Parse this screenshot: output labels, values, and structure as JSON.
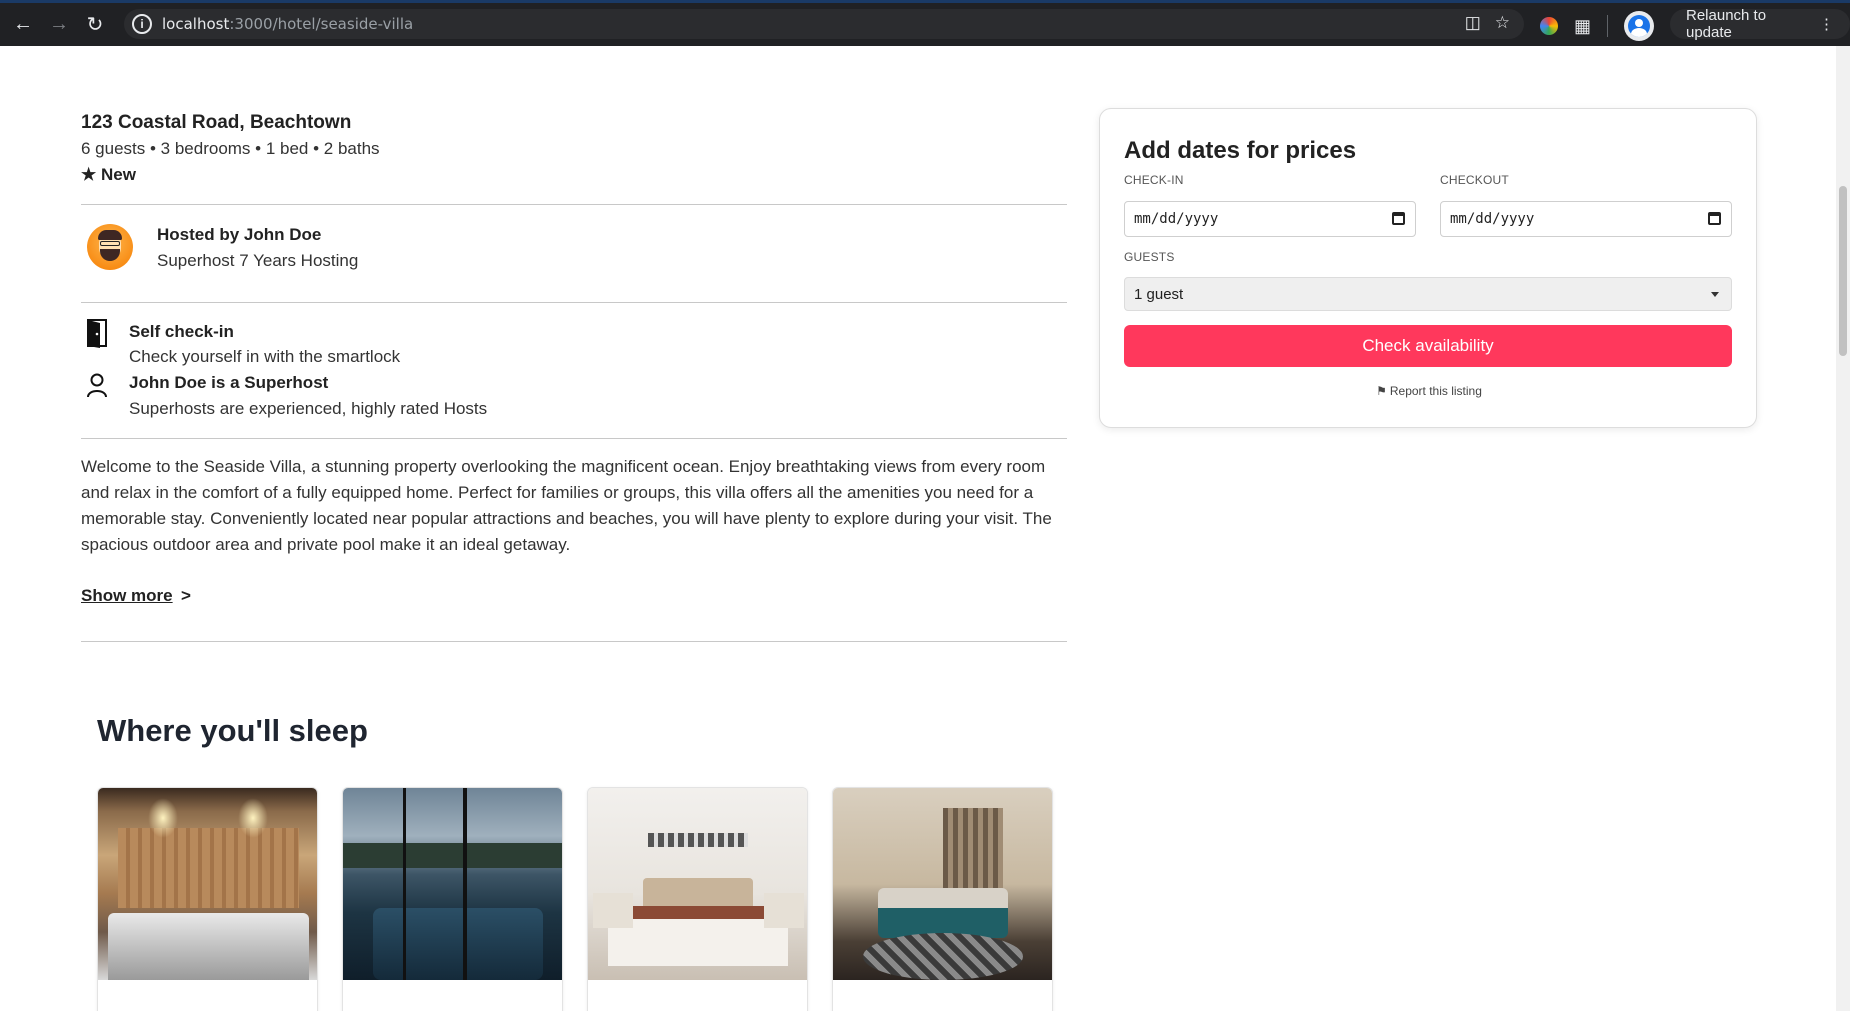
{
  "browser": {
    "url_host": "localhost",
    "url_path": ":3000/hotel/seaside-villa",
    "relaunch_label": "Relaunch to update"
  },
  "listing": {
    "address": "123 Coastal Road, Beachtown",
    "specs": "6 guests • 3 bedrooms • 1 bed • 2 baths",
    "badge": "★ New"
  },
  "host": {
    "name": "Hosted by John Doe",
    "subtitle": "Superhost 7 Years Hosting"
  },
  "features": [
    {
      "icon": "door-icon",
      "title": "Self check-in",
      "text": "Check yourself in with the smartlock"
    },
    {
      "icon": "user-icon",
      "title": "John Doe is a Superhost",
      "text": "Superhosts are experienced, highly rated Hosts"
    }
  ],
  "description": "Welcome to the Seaside Villa, a stunning property overlooking the magnificent ocean. Enjoy breathtaking views from every room and relax in the comfort of a fully equipped home. Perfect for families or groups, this villa offers all the amenities you need for a memorable stay. Conveniently located near popular attractions and beaches, you will have plenty to explore during your visit. The spacious outdoor area and private pool make it an ideal getaway.",
  "show_more": {
    "label": "Show more",
    "arrow": ">"
  },
  "sleep": {
    "title": "Where you'll sleep"
  },
  "booking": {
    "title": "Add dates for prices",
    "checkin_label": "CHECK-IN",
    "checkout_label": "CHECKOUT",
    "date_placeholder": "mm/dd/yyyy",
    "guests_label": "GUESTS",
    "guests_value": "1 guest",
    "button_label": "Check availability",
    "report_label": "Report this listing",
    "accent_color": "#ff385c"
  }
}
